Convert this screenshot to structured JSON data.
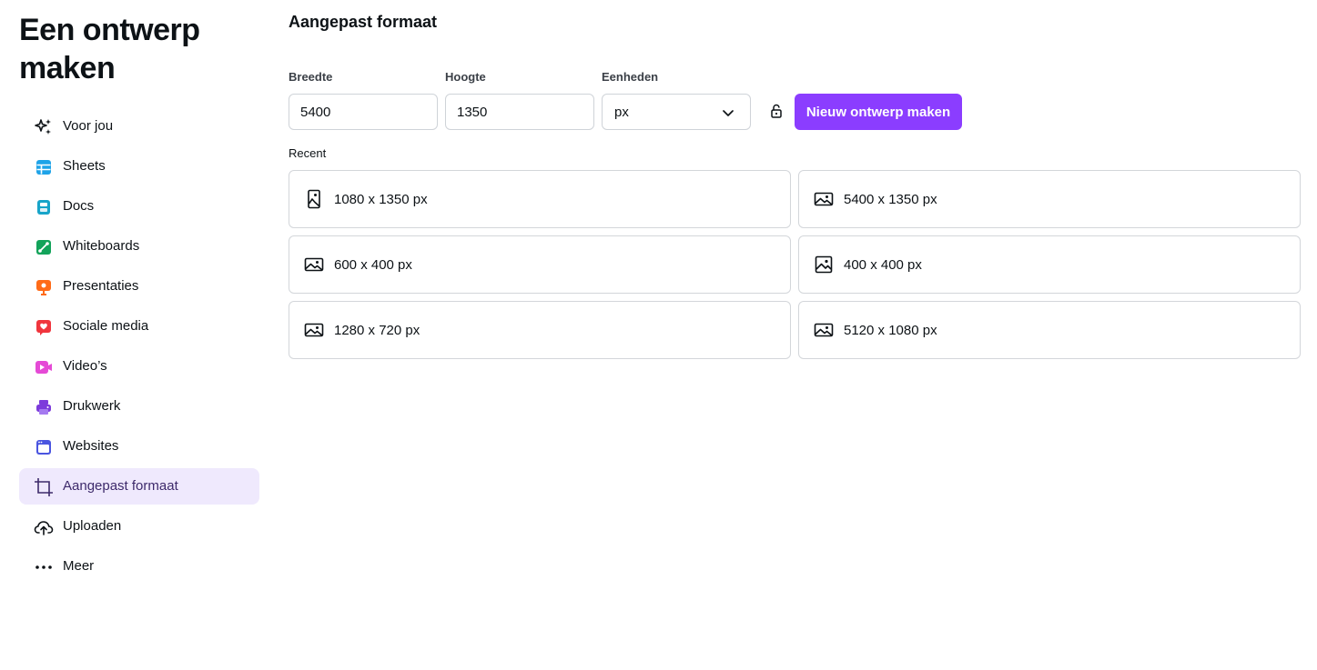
{
  "sidebar": {
    "title": "Een ontwerp maken",
    "items": [
      {
        "label": "Voor jou",
        "icon": "sparkles-icon"
      },
      {
        "label": "Sheets",
        "icon": "sheets-icon"
      },
      {
        "label": "Docs",
        "icon": "docs-icon"
      },
      {
        "label": "Whiteboards",
        "icon": "whiteboards-icon"
      },
      {
        "label": "Presentaties",
        "icon": "presentations-icon"
      },
      {
        "label": "Sociale media",
        "icon": "social-media-icon"
      },
      {
        "label": "Video’s",
        "icon": "video-icon"
      },
      {
        "label": "Drukwerk",
        "icon": "print-icon"
      },
      {
        "label": "Websites",
        "icon": "websites-icon"
      },
      {
        "label": "Aangepast formaat",
        "icon": "custom-size-icon",
        "active": true
      },
      {
        "label": "Uploaden",
        "icon": "upload-cloud-icon"
      },
      {
        "label": "Meer",
        "icon": "more-icon"
      }
    ]
  },
  "main": {
    "heading": "Aangepast formaat",
    "width_label": "Breedte",
    "width_value": "5400",
    "height_label": "Hoogte",
    "height_value": "1350",
    "units_label": "Eenheden",
    "units_value": "px",
    "create_button": "Nieuw ontwerp maken",
    "recent_label": "Recent",
    "recent": [
      {
        "label": "1080 x 1350 px",
        "orientation": "portrait"
      },
      {
        "label": "5400 x 1350 px",
        "orientation": "landscape"
      },
      {
        "label": "600 x 400 px",
        "orientation": "landscape"
      },
      {
        "label": "400 x 400 px",
        "orientation": "square"
      },
      {
        "label": "1280 x 720 px",
        "orientation": "landscape"
      },
      {
        "label": "5120 x 1080 px",
        "orientation": "landscape"
      }
    ]
  },
  "colors": {
    "accent": "#8b3dff",
    "active_bg": "#efe9fd",
    "text": "#0d1216",
    "border": "#d3d6da"
  }
}
